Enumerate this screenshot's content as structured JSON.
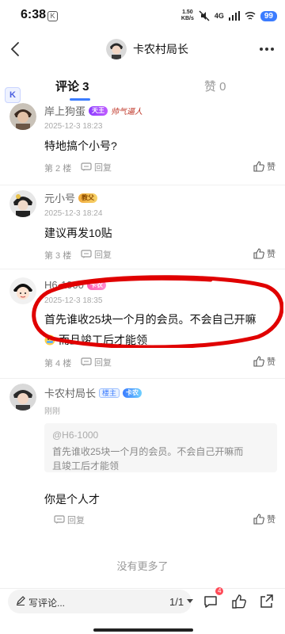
{
  "status_bar": {
    "time": "6:38",
    "speed_value": "1.50",
    "speed_unit": "KB/s",
    "network": "4G",
    "battery": "99"
  },
  "header": {
    "title": "卡农村局长"
  },
  "tabs": [
    {
      "label": "评论 3"
    },
    {
      "label": "赞 0"
    }
  ],
  "floating_button": "K",
  "comments": [
    {
      "user": "岸上狗蛋",
      "badges": [
        "天王"
      ],
      "signature": "帅气逼人",
      "time": "2025-12-3 18:23",
      "text": "特地搞个小号?",
      "floor": "第 2 楼",
      "reply_label": "回复",
      "like_label": "赞"
    },
    {
      "user": "元小号",
      "badges": [
        "教父"
      ],
      "time": "2025-12-3 18:24",
      "text": "建议再发10贴",
      "floor": "第 3 楼",
      "reply_label": "回复",
      "like_label": "赞"
    },
    {
      "user": "H6-1000",
      "badges": [
        "卡农"
      ],
      "time": "2025-12-3 18:35",
      "text_line1": "首先谁收25块一个月的会员。不会自己开嘛",
      "text_line2": "而且竣工后才能领",
      "floor": "第 4 楼",
      "reply_label": "回复",
      "like_label": "赞"
    },
    {
      "user": "卡农村局长",
      "badges": [
        "楼主",
        "卡农"
      ],
      "time": "刚刚",
      "quote_user": "@H6-1000",
      "quote_text_line1": "首先谁收25块一个月的会员。不会自己开嘛而",
      "quote_text_line2": "且竣工后才能领",
      "text": "你是个人才",
      "reply_label": "回复",
      "like_label": "赞"
    }
  ],
  "footer": {
    "no_more": "没有更多了"
  },
  "bottom_bar": {
    "write_label": "写评论...",
    "page": "1/1",
    "notification_count": "4"
  },
  "colors": {
    "accent": "#3b7cff",
    "annotation": "#e00000"
  }
}
